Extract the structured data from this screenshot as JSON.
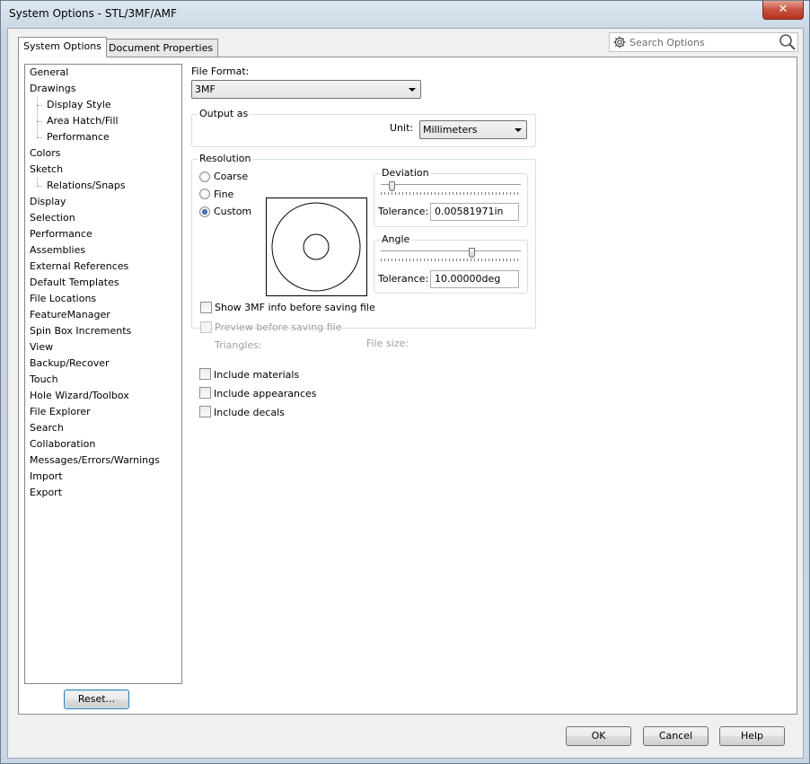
{
  "window": {
    "title": "System Options - STL/3MF/AMF",
    "close_glyph": "✕"
  },
  "tabs": [
    {
      "label": "System Options",
      "active": true
    },
    {
      "label": "Document Properties",
      "active": false
    }
  ],
  "search": {
    "placeholder": "Search Options"
  },
  "tree": [
    {
      "label": "General",
      "indent": 0
    },
    {
      "label": "Drawings",
      "indent": 0
    },
    {
      "label": "Display Style",
      "indent": 1
    },
    {
      "label": "Area Hatch/Fill",
      "indent": 1
    },
    {
      "label": "Performance",
      "indent": 1
    },
    {
      "label": "Colors",
      "indent": 0
    },
    {
      "label": "Sketch",
      "indent": 0
    },
    {
      "label": "Relations/Snaps",
      "indent": 1
    },
    {
      "label": "Display",
      "indent": 0
    },
    {
      "label": "Selection",
      "indent": 0
    },
    {
      "label": "Performance",
      "indent": 0
    },
    {
      "label": "Assemblies",
      "indent": 0
    },
    {
      "label": "External References",
      "indent": 0
    },
    {
      "label": "Default Templates",
      "indent": 0
    },
    {
      "label": "File Locations",
      "indent": 0
    },
    {
      "label": "FeatureManager",
      "indent": 0
    },
    {
      "label": "Spin Box Increments",
      "indent": 0
    },
    {
      "label": "View",
      "indent": 0
    },
    {
      "label": "Backup/Recover",
      "indent": 0
    },
    {
      "label": "Touch",
      "indent": 0
    },
    {
      "label": "Hole Wizard/Toolbox",
      "indent": 0
    },
    {
      "label": "File Explorer",
      "indent": 0
    },
    {
      "label": "Search",
      "indent": 0
    },
    {
      "label": "Collaboration",
      "indent": 0
    },
    {
      "label": "Messages/Errors/Warnings",
      "indent": 0
    },
    {
      "label": "Import",
      "indent": 0
    },
    {
      "label": "Export",
      "indent": 0
    }
  ],
  "reset_label": "Reset...",
  "file_format": {
    "label": "File Format:",
    "value": "3MF"
  },
  "output_as": {
    "group_label": "Output as",
    "unit_label": "Unit:",
    "unit_value": "Millimeters"
  },
  "resolution": {
    "group_label": "Resolution",
    "options": [
      {
        "label": "Coarse",
        "checked": false
      },
      {
        "label": "Fine",
        "checked": false
      },
      {
        "label": "Custom",
        "checked": true
      }
    ],
    "deviation": {
      "group_label": "Deviation",
      "tolerance_label": "Tolerance:",
      "tolerance_value": "0.00581971in",
      "slider_fraction": 0.06
    },
    "angle": {
      "group_label": "Angle",
      "tolerance_label": "Tolerance:",
      "tolerance_value": "10.00000deg",
      "slider_fraction": 0.66
    },
    "show_info": {
      "label": "Show 3MF info before saving file",
      "checked": false
    },
    "preview": {
      "label": "Preview before saving file",
      "checked": false,
      "disabled": true
    },
    "triangles_label": "Triangles:",
    "file_size_label": "File size:"
  },
  "include": [
    {
      "label": "Include materials",
      "checked": false
    },
    {
      "label": "Include appearances",
      "checked": false
    },
    {
      "label": "Include decals",
      "checked": false
    }
  ],
  "buttons": {
    "ok": "OK",
    "cancel": "Cancel",
    "help": "Help"
  }
}
